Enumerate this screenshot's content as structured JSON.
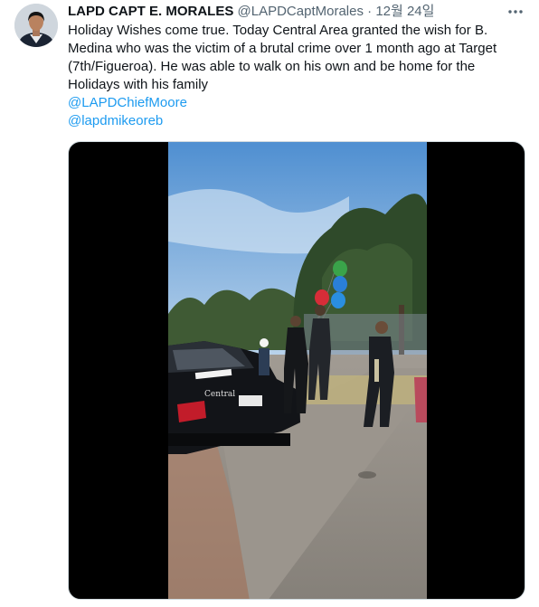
{
  "author": {
    "display_name": "LAPD CAPT E. MORALES",
    "handle": "@LAPDCaptMorales",
    "separator": "·",
    "date": "12월 24일"
  },
  "tweet": {
    "paragraph": "Holiday Wishes come true.  Today Central Area granted the wish for B. Medina who was the victim of a brutal crime over 1 month ago at Target (7th/Figueroa). He was able to walk on his own and be home for the Holidays with his family",
    "mentions": [
      "@LAPDChiefMoore",
      "@lapdmikeoreb"
    ]
  },
  "media": {
    "car_door_text": "Central"
  },
  "icons": {
    "more": "more-horizontal-icon"
  },
  "colors": {
    "link": "#1d9bf0",
    "secondary_text": "#536471",
    "primary_text": "#0f1419"
  }
}
